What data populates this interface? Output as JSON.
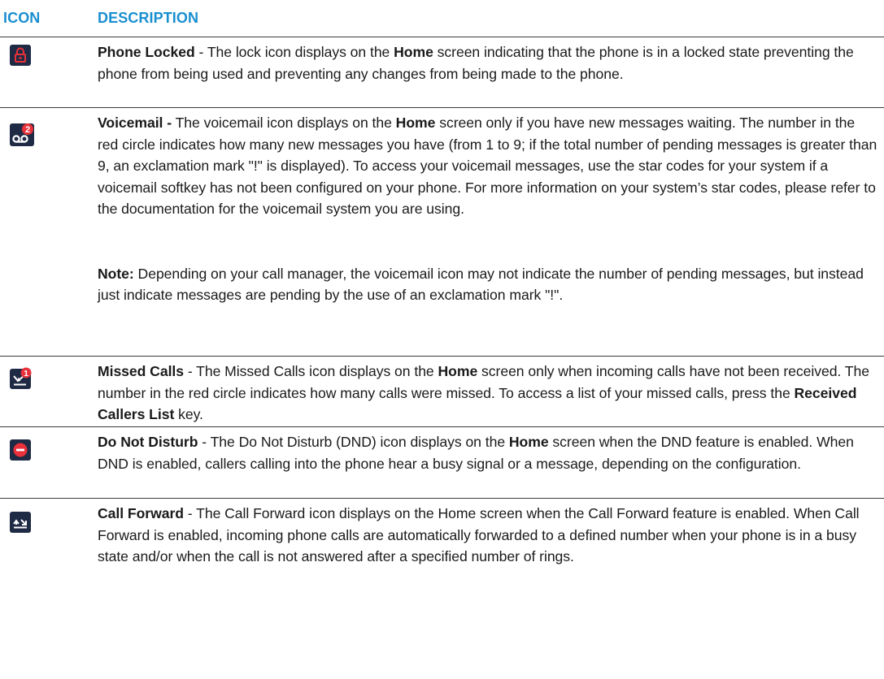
{
  "header": {
    "icon_col": "ICON",
    "desc_col": "DESCRIPTION"
  },
  "rows": [
    {
      "icon": "lock-icon",
      "title": "Phone Locked",
      "parts": [
        " - The lock icon displays on the ",
        "Home",
        " screen indicating that the phone is in a locked state preventing the phone from being used and preventing any changes from being made to the phone."
      ]
    },
    {
      "icon": "voicemail-icon",
      "badge": "2",
      "title": "Voicemail -",
      "parts": [
        " The voicemail icon displays on the ",
        "Home",
        " screen only if you have new messages waiting. The number in the red circle indicates how many new messages you have (from 1 to 9; if the total number of pending messages is greater than 9, an exclamation mark \"!\" is displayed). To access your voicemail messages, use the star codes for your system if a voicemail softkey has not been configured on your phone. For more information on your system’s star codes, please refer to the documentation for the voicemail system you are using."
      ],
      "note_label": "Note:",
      "note_text": " Depending on your call manager, the voicemail icon may not indicate the number of pending messages, but instead just indicate messages are pending by the use of an exclamation mark \"!\"."
    },
    {
      "icon": "missed-calls-icon",
      "badge": "1",
      "title": "Missed Calls",
      "parts": [
        " - The Missed Calls icon displays on the ",
        "Home",
        " screen only when incoming calls have not been received. The number in the red circle indicates how many calls were missed. To access a list of your missed calls, press the ",
        "Received Callers List",
        " key."
      ]
    },
    {
      "icon": "do-not-disturb-icon",
      "title": "Do Not Disturb",
      "parts": [
        " - The Do Not Disturb (DND) icon displays on the ",
        "Home",
        " screen when the DND feature is enabled. When DND is enabled, callers calling into the phone hear a busy signal or a message, depending on the configuration."
      ]
    },
    {
      "icon": "call-forward-icon",
      "title": "Call Forward",
      "parts": [
        " - The Call Forward icon displays on the Home screen when the Call Forward feature is enabled. When Call Forward is enabled, incoming phone calls are automatically forwarded to a defined number when your phone is in a busy state and/or when the call is not answered after a specified number of rings."
      ]
    }
  ],
  "colors": {
    "header_text": "#1a8fd0",
    "icon_bg": "#1f2a44",
    "alert_red": "#e8313a",
    "rule": "#3a3a3a"
  }
}
